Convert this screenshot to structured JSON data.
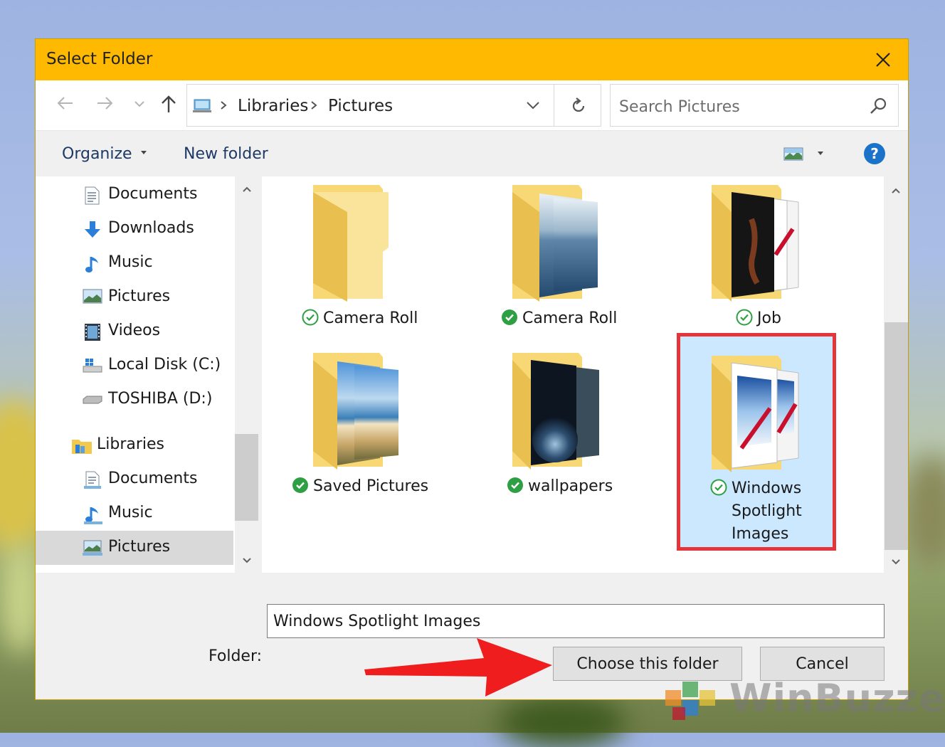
{
  "window": {
    "title": "Select Folder"
  },
  "address": {
    "segments": [
      "Libraries",
      "Pictures"
    ]
  },
  "search": {
    "placeholder": "Search Pictures"
  },
  "toolbar": {
    "organize": "Organize",
    "new_folder": "New folder",
    "help": "?"
  },
  "nav": {
    "items": [
      {
        "label": "Documents",
        "icon": "document-icon"
      },
      {
        "label": "Downloads",
        "icon": "download-icon"
      },
      {
        "label": "Music",
        "icon": "music-icon"
      },
      {
        "label": "Pictures",
        "icon": "picture-icon"
      },
      {
        "label": "Videos",
        "icon": "video-icon"
      },
      {
        "label": "Local Disk (C:)",
        "icon": "windows-drive-icon"
      },
      {
        "label": "TOSHIBA (D:)",
        "icon": "drive-icon"
      },
      {
        "label": "Libraries",
        "icon": "libraries-icon"
      },
      {
        "label": "Documents",
        "icon": "document-icon"
      },
      {
        "label": "Music",
        "icon": "music-icon"
      },
      {
        "label": "Pictures",
        "icon": "picture-icon",
        "selected": true
      }
    ]
  },
  "files": [
    {
      "name": "Camera Roll",
      "style": "empty",
      "status": "synced-outline"
    },
    {
      "name": "Camera Roll",
      "style": "sea",
      "status": "synced-filled"
    },
    {
      "name": "Job",
      "style": "dark",
      "status": "synced-outline"
    },
    {
      "name": "Saved Pictures",
      "style": "beach",
      "status": "synced-filled"
    },
    {
      "name": "wallpapers",
      "style": "space",
      "status": "synced-filled"
    },
    {
      "name": "Windows Spotlight Images",
      "name_lines": [
        "Windows",
        "Spotlight",
        "Images"
      ],
      "style": "paint",
      "status": "synced-outline",
      "selected": true
    }
  ],
  "footer": {
    "folder_label": "Folder:",
    "folder_value": "Windows Spotlight Images",
    "choose_label": "Choose this folder",
    "cancel_label": "Cancel"
  },
  "watermark": {
    "text": "WinBuzzer"
  },
  "colors": {
    "titlebar": "#ffb900",
    "selection": "#cce8ff",
    "highlight": "#e5353b",
    "sync_green": "#2ea043"
  }
}
